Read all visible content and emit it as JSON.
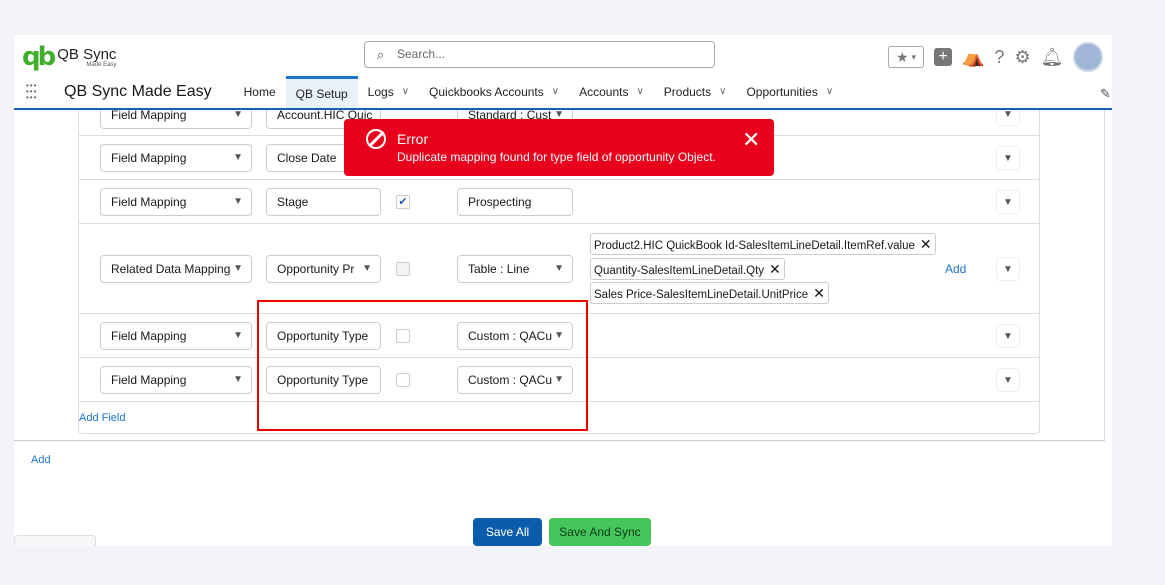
{
  "header": {
    "logo_title": "QB Sync",
    "logo_sub": "Made Easy",
    "search_placeholder": "Search..."
  },
  "nav": {
    "app_name": "QB Sync Made Easy",
    "tabs": [
      {
        "label": "Home"
      },
      {
        "label": "QB Setup"
      },
      {
        "label": "Logs"
      },
      {
        "label": "Quickbooks Accounts"
      },
      {
        "label": "Accounts"
      },
      {
        "label": "Products"
      },
      {
        "label": "Opportunities"
      }
    ]
  },
  "toast": {
    "title": "Error",
    "message": "Duplicate mapping found for type field of opportunity Object."
  },
  "rows": [
    {
      "type": "Field Mapping",
      "field": "Account.HIC Quic",
      "target": "Standard : Cust"
    },
    {
      "type": "Field Mapping",
      "field": "Close Date"
    },
    {
      "type": "Field Mapping",
      "field": "Stage",
      "checked": true,
      "target": "Prospecting"
    },
    {
      "type": "Related Data Mapping",
      "field": "Opportunity Pr",
      "target": "Table : Line",
      "pills": [
        "Product2.HIC QuickBook Id-SalesItemLineDetail.ItemRef.value",
        "Quantity-SalesItemLineDetail.Qty",
        "Sales Price-SalesItemLineDetail.UnitPrice"
      ],
      "add": "Add"
    },
    {
      "type": "Field Mapping",
      "field": "Opportunity Type",
      "target": "Custom : QACu"
    },
    {
      "type": "Field Mapping",
      "field": "Opportunity Type",
      "target": "Custom : QACu"
    }
  ],
  "add_field": "Add Field",
  "add": "Add",
  "buttons": {
    "save_all": "Save All",
    "save_sync": "Save And Sync"
  },
  "colors": {
    "error": "#e8001c",
    "primary": "#0b5cab",
    "success": "#45c65a"
  }
}
